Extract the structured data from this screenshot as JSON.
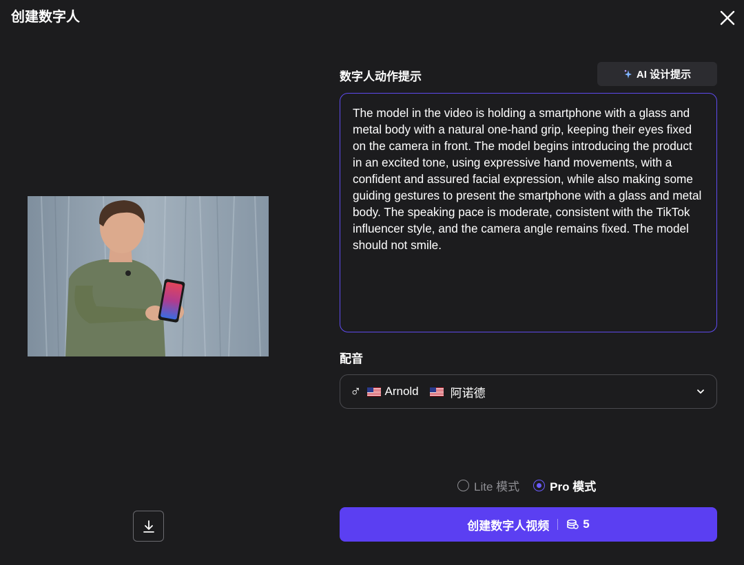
{
  "header": {
    "title": "创建数字人"
  },
  "preview": {
    "description_icon": "person-holding-phone-image"
  },
  "prompt": {
    "label": "数字人动作提示",
    "ai_button_label": "AI 设计提示",
    "value": "The model in the video is holding a smartphone with a glass and metal body with a natural one-hand grip, keeping their eyes fixed on the camera in front. The model begins introducing the product in an excited tone, using expressive hand movements, with a confident and assured facial expression, while also making some guiding gestures to present the smartphone with a glass and metal body. The speaking pace is moderate, consistent with the TikTok influencer style, and the camera angle remains fixed. The model should not smile."
  },
  "voice": {
    "label": "配音",
    "gender_symbol": "♂",
    "name_en": "Arnold",
    "name_zh": "阿诺德"
  },
  "modes": {
    "lite_label": "Lite 模式",
    "pro_label": "Pro 模式",
    "selected": "pro"
  },
  "create": {
    "label": "创建数字人视频",
    "cost": "5"
  },
  "colors": {
    "accent": "#5b3ff2",
    "background": "#1c1c1e",
    "focus_border": "#5f4bf0"
  }
}
